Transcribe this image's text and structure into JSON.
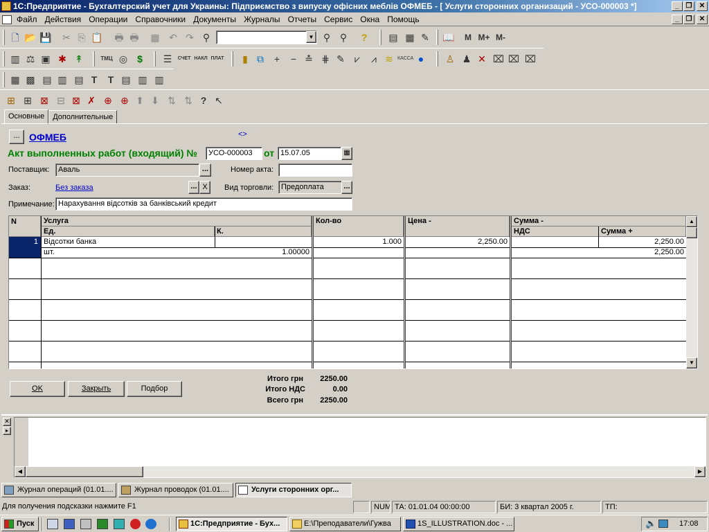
{
  "window": {
    "title": "1С:Предприятие - Бухгалтерский учет для Украины: Підприємство з випуску офісних меблів ОФМЕБ - [ Услуги сторонних организаций - УСО-000003 *]"
  },
  "menu": [
    "Файл",
    "Действия",
    "Операции",
    "Справочники",
    "Документы",
    "Журналы",
    "Отчеты",
    "Сервис",
    "Окна",
    "Помощь"
  ],
  "toolbar": {
    "memory_buttons": [
      "M",
      "M+",
      "M-"
    ],
    "search_value": ""
  },
  "tabs": [
    "Основные",
    "Дополнительные"
  ],
  "form": {
    "org_button": "...",
    "org_name": "ОФМЕБ",
    "nav_arrows": "<>",
    "doc_title": "Акт выполненных работ (входящий) №",
    "doc_number": "УСО-000003",
    "from_label": "от",
    "doc_date": "15.07.05",
    "supplier_label": "Поставщик:",
    "supplier_value": "Аваль",
    "act_number_label": "Номер акта:",
    "act_number_value": "",
    "order_label": "Заказ:",
    "order_value": "Без заказа",
    "trade_type_label": "Вид торговли:",
    "trade_type_value": "Предоплата",
    "note_label": "Примечание:",
    "note_value": "Нарахування відсотків за банківський кредит",
    "ellipsis": "...",
    "clear_x": "X"
  },
  "grid": {
    "headers": {
      "n": "N",
      "service": "Услуга",
      "unit": "Ед.",
      "coef": "К.",
      "qty": "Кол-во",
      "price": "Цена -",
      "sum": "Сумма -",
      "vat": "НДС",
      "sum_plus": "Сумма +"
    },
    "rows": [
      {
        "n": "1",
        "service": "Відсотки банка",
        "unit": "шт.",
        "coef": "1.00000",
        "qty": "1.000",
        "price": "2,250.00",
        "sum": "2,250.00",
        "vat": "",
        "sum_plus": "2,250.00"
      }
    ]
  },
  "buttons": {
    "ok": "OK",
    "close": "Закрыть",
    "select": "Подбор"
  },
  "totals": {
    "total_label": "Итого грн",
    "total_value": "2250.00",
    "vat_label": "Итого НДС",
    "vat_value": "0.00",
    "grand_label": "Всего грн",
    "grand_value": "2250.00"
  },
  "taskwindows": [
    "Журнал операций (01.01....",
    "Журнал проводок (01.01....",
    "Услуги сторонних орг..."
  ],
  "status": {
    "hint": "Для получения подсказки нажмите F1",
    "num": "NUM",
    "ta": "ТА: 01.01.04  00:00:00",
    "bi": "БИ: 3 квартал 2005 г.",
    "tp": "ТП:"
  },
  "taskbar": {
    "start": "Пуск",
    "items": [
      "1С:Предприятие - Бух...",
      "E:\\Преподаватели\\Гужва",
      "1S_ILLUSTRATION.doc - ..."
    ],
    "clock": "17:08"
  },
  "colors": {
    "title_bar": "#0a246a",
    "doc_title": "#008000",
    "link": "#0000cc",
    "selected_cell": "#0a246a"
  }
}
